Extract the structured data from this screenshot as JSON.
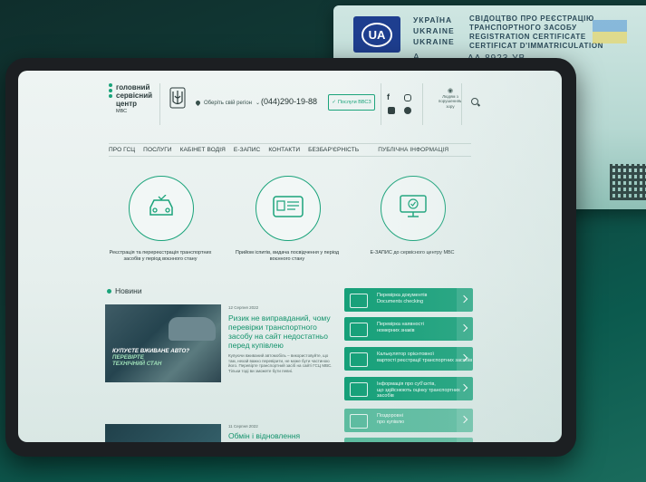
{
  "certificate": {
    "emblem": "UA",
    "country_lines": [
      "УКРАЇНА",
      "UKRAINE",
      "UKRAINE"
    ],
    "title_lines": [
      "СВІДОЦТВО ПРО РЕЄСТРАЦІЮ",
      "ТРАНСПОРТНОГО ЗАСОБУ",
      "REGISTRATION CERTIFICATE",
      "CERTIFICAT D'IMMATRICULATION"
    ],
    "series_letter": "А",
    "number": "АА 8923 УВ"
  },
  "header": {
    "logo_lines": [
      "головний",
      "сервісний",
      "центр"
    ],
    "logo_sub": "МВС",
    "region_label": "Оберіть свій регіон",
    "phone": "(044)290-19-88",
    "services_button": "Послуги ВВСЗ",
    "accessibility_label": [
      "Людям з",
      "порушенням",
      "зору"
    ]
  },
  "nav": {
    "items": [
      "ПРО ГСЦ",
      "ПОСЛУГИ",
      "КАБІНЕТ ВОДІЯ",
      "Е-ЗАПИС",
      "КОНТАКТИ",
      "БЕЗБАР'ЄРНІСТЬ",
      "ПУБЛІЧНА ІНФОРМАЦІЯ"
    ]
  },
  "services": [
    {
      "label": "Реєстрація та перереєстрація транспортних засобів у період воєнного стану"
    },
    {
      "label": "Прийом іспитів, видача посвідчення у період воєнного стану"
    },
    {
      "label": "Е-ЗАПИС до сервісного центру МВС"
    }
  ],
  "news": {
    "heading": "Новини",
    "item1": {
      "date": "12 Серпня 2022",
      "title": "Ризик не виправданий, чому перевірки транспортного засобу на сайт недостатньо перед купівлею",
      "body": "Купуючи вживаний автомобіль – використовуйте, що там, нехай важко перевірити, не може бути частиною його. Перевірте транспортний засіб на сайті ГСЦ МВС. Тільки тоді ви зможете бути певні.",
      "image_text_line1": "КУПУЄТЕ ВЖИВАНЕ АВТО?",
      "image_text_line2": "ПЕРЕВІРТЕ",
      "image_text_line3": "ТЕХНІЧНИЙ СТАН"
    },
    "item2": {
      "date": "11 Серпня 2022",
      "title": "Обмін і відновлення"
    }
  },
  "quick_links": [
    {
      "line1": "Перевірка документів",
      "line2": "Documents checking"
    },
    {
      "line1": "Перевірка наявності",
      "line2": "номерних знаків"
    },
    {
      "line1": "Калькулятор орієнтовної",
      "line2": "вартості реєстрації транспортних засобів"
    },
    {
      "line1": "Інформація про суб'єктів,",
      "line2": "що здійснюють оцінку транспортних засобів"
    },
    {
      "line1": "Поздоровні",
      "line2": "про купівлю"
    },
    {
      "line1": "",
      "line2": ""
    }
  ],
  "colors": {
    "accent": "#16a079",
    "link": "#14936c",
    "text": "#2a3a3a"
  }
}
